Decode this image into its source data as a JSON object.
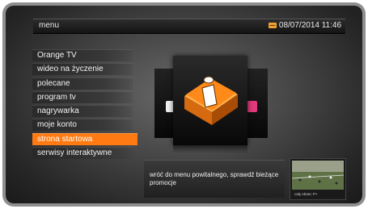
{
  "header": {
    "title": "menu",
    "datetime": "08/07/2014 11:46",
    "mail_icon": "mail-icon"
  },
  "menu": {
    "items": [
      {
        "label": "Orange TV"
      },
      {
        "label": "wideo na życzenie"
      },
      {
        "label": "polecane"
      },
      {
        "label": "program tv"
      },
      {
        "label": "nagrywarka"
      },
      {
        "label": "moje konto"
      },
      {
        "label": "strona startowa"
      },
      {
        "label": "serwisy interaktywne"
      }
    ],
    "selected_index": 6
  },
  "carousel": {
    "center_icon": "info-icon",
    "left_icon": "tv-icon",
    "right_icon": "vod-icon"
  },
  "description": {
    "text": "wróć do menu powitalnego, sprawdź bieżące promocje"
  },
  "pip": {
    "caption": "cały ekran: P+"
  },
  "colors": {
    "accent": "#ff7a12",
    "icon_orange": "#f08a1e",
    "background": "#3b3b3b"
  }
}
